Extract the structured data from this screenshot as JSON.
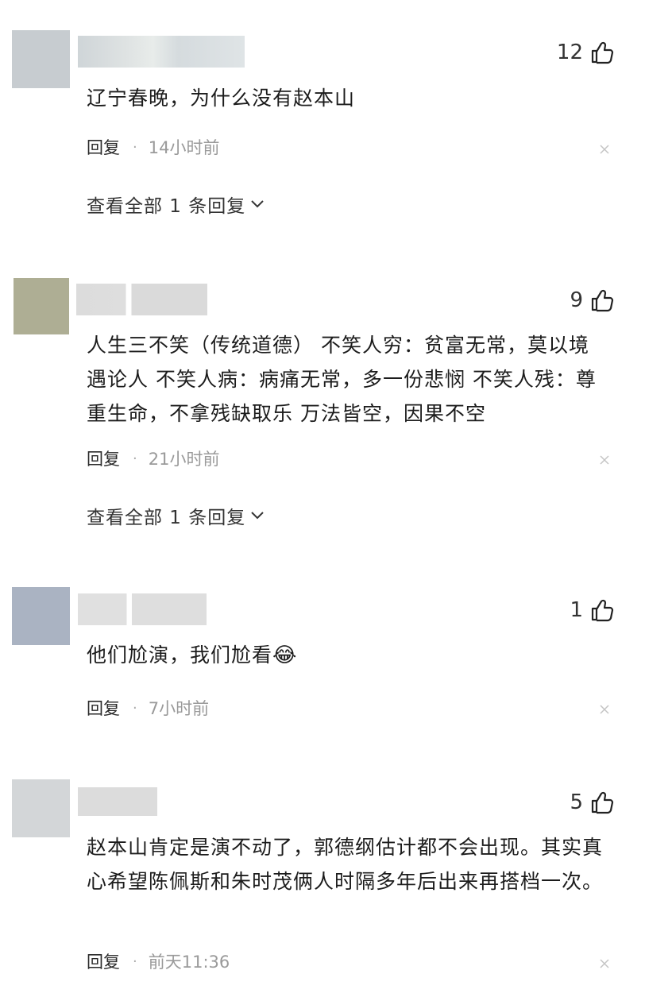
{
  "comments": [
    {
      "likes": "12",
      "text": "辽宁春晚，为什么没有赵本山",
      "reply_label": "回复",
      "separator": "·",
      "time": "14小时前",
      "view_all": "查看全部 1 条回复",
      "avatar_color": "#c7ccd0"
    },
    {
      "likes": "9",
      "text": "人生三不笑（传统道德） 不笑人穷：贫富无常，莫以境遇论人 不笑人病：病痛无常，多一份悲悯 不笑人残：尊重生命，不拿残缺取乐 万法皆空，因果不空",
      "reply_label": "回复",
      "separator": "·",
      "time": "21小时前",
      "view_all": "查看全部 1 条回复",
      "avatar_color": "#aeae94"
    },
    {
      "likes": "1",
      "text": "他们尬演，我们尬看",
      "emoji": "😂",
      "reply_label": "回复",
      "separator": "·",
      "time": "7小时前",
      "avatar_color": "#aab3c2"
    },
    {
      "likes": "5",
      "text": "赵本山肯定是演不动了，郭德纲估计都不会出现。其实真心希望陈佩斯和朱时茂俩人时隔多年后出来再搭档一次。",
      "reply_label": "回复",
      "separator": "·",
      "time": "前天11:36",
      "avatar_color": "#d3d6d8"
    }
  ]
}
